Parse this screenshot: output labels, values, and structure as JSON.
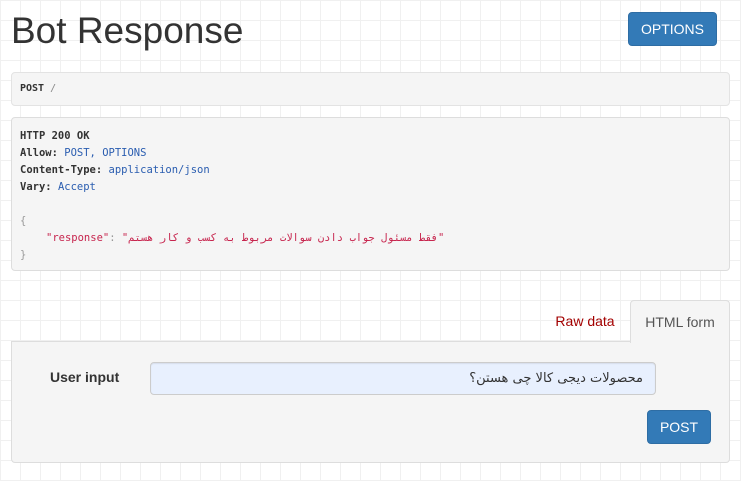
{
  "header": {
    "title": "Bot Response",
    "options_label": "OPTIONS"
  },
  "request": {
    "method": "POST",
    "path": "/"
  },
  "response": {
    "status_line": "HTTP 200 OK",
    "headers": [
      {
        "key": "Allow:",
        "value": "POST, OPTIONS"
      },
      {
        "key": "Content-Type:",
        "value": "application/json"
      },
      {
        "key": "Vary:",
        "value": "Accept"
      }
    ],
    "body_open": "{",
    "body_key": "\"response\"",
    "body_sep": ": ",
    "body_value": "\"فقط مسئول جواب دادن سوالات مربوط به کسب و کار هستم\"",
    "body_close": "}"
  },
  "tabs": {
    "raw_label": "Raw data",
    "html_label": "HTML form",
    "active": "HTML form"
  },
  "form": {
    "field_label": "User input",
    "field_value": "محصولات دیجی کالا چی هستن؟",
    "submit_label": "POST"
  },
  "colors": {
    "primary_button": "#337ab7",
    "header_value": "#2a5db0",
    "json_string": "#c7254e",
    "raw_tab_link": "#a30000",
    "input_autofill_bg": "#e8f0fe"
  }
}
